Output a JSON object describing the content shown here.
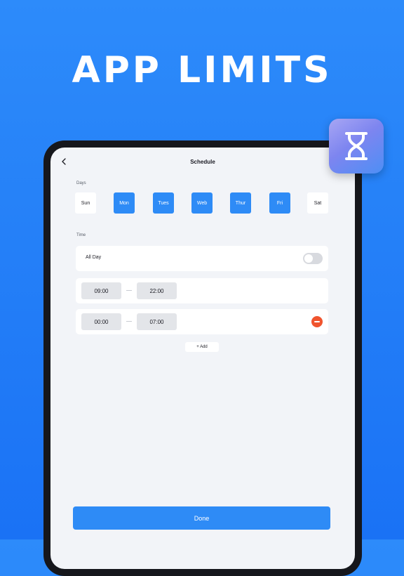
{
  "headline": "APP LIMITS",
  "app_icon": {
    "icon": "hourglass-icon"
  },
  "nav": {
    "back_icon": "chevron-left-icon",
    "title": "Schedule"
  },
  "days": {
    "label": "Days",
    "items": [
      {
        "label": "Sun",
        "selected": false
      },
      {
        "label": "Mon",
        "selected": true
      },
      {
        "label": "Tues",
        "selected": true
      },
      {
        "label": "Web",
        "selected": true
      },
      {
        "label": "Thur",
        "selected": true
      },
      {
        "label": "Fri",
        "selected": true
      },
      {
        "label": "Sat",
        "selected": false
      }
    ]
  },
  "time": {
    "label": "Time",
    "all_day_label": "All Day",
    "all_day_enabled": false,
    "ranges": [
      {
        "start": "09:00",
        "end": "22:00",
        "removable": false
      },
      {
        "start": "00:00",
        "end": "07:00",
        "removable": true
      }
    ],
    "add_label": "+ Add"
  },
  "done_label": "Done",
  "colors": {
    "background": "#1F7BF7",
    "accent": "#2E8BF6",
    "remove": "#F0542E"
  }
}
